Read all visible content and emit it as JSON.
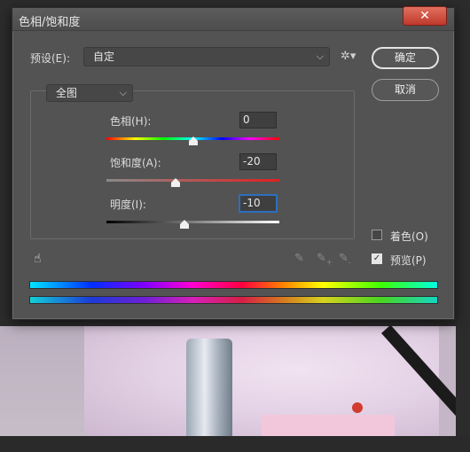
{
  "dialog": {
    "title": "色相/饱和度",
    "close_glyph": "✕",
    "preset_label": "预设(E):",
    "preset_value": "自定",
    "ok_label": "确定",
    "cancel_label": "取消",
    "range_value": "全图",
    "sliders": [
      {
        "label": "色相(H):",
        "value": "0",
        "level": 0.5
      },
      {
        "label": "饱和度(A):",
        "value": "-20",
        "level": 0.4
      },
      {
        "label": "明度(I):",
        "value": "-10",
        "level": 0.45
      }
    ],
    "colorize_label": "着色(O)",
    "colorize_checked": false,
    "preview_label": "预览(P)",
    "preview_checked": true,
    "icons": {
      "close": "close-icon",
      "gear": "gear-icon",
      "chevron": "chevron-down-icon",
      "hand": "targeted-adjustment-hand-icon",
      "eyedropper": "eyedropper-icon",
      "eyedropper_add": "eyedropper-add-icon",
      "eyedropper_subtract": "eyedropper-subtract-icon"
    },
    "colors": {
      "dialog_bg": "#535353",
      "close_button": "#c0392b",
      "focus_border": "#2d6fbd"
    }
  }
}
